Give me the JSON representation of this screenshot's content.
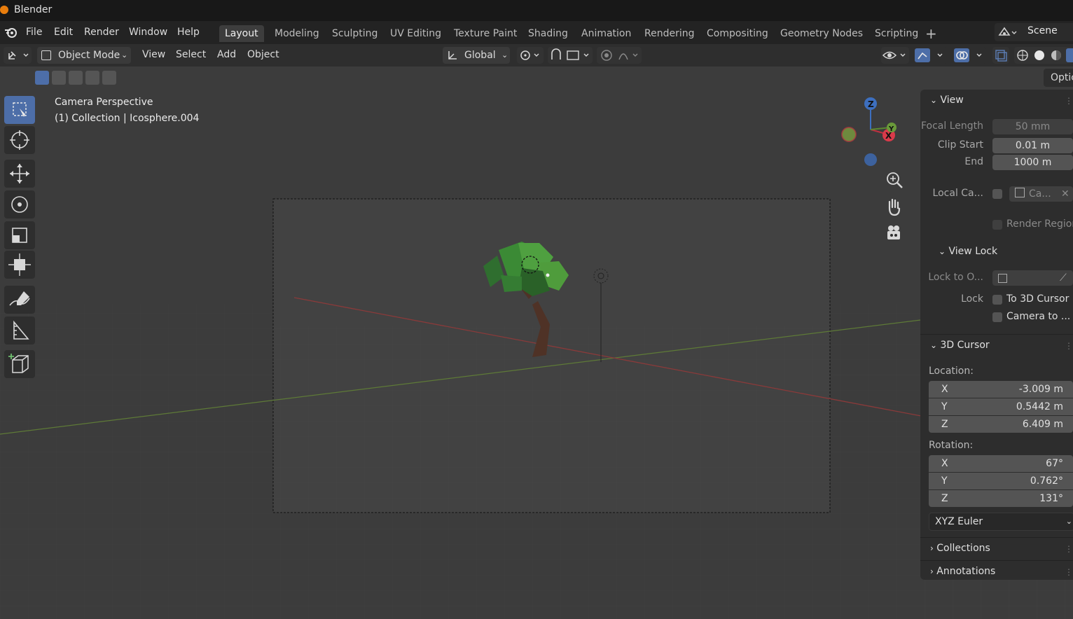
{
  "window": {
    "title": "Blender"
  },
  "menu": [
    "File",
    "Edit",
    "Render",
    "Window",
    "Help"
  ],
  "workspaces": [
    "Layout",
    "Modeling",
    "Sculpting",
    "UV Editing",
    "Texture Paint",
    "Shading",
    "Animation",
    "Rendering",
    "Compositing",
    "Geometry Nodes",
    "Scripting"
  ],
  "active_workspace": "Layout",
  "scene": {
    "name": "Scene"
  },
  "header": {
    "mode": "Object Mode",
    "view": "View",
    "select": "Select",
    "add": "Add",
    "object": "Object",
    "orientation": "Global",
    "options": "Optic"
  },
  "viewport": {
    "title": "Camera Perspective",
    "subtitle": "(1) Collection | Icosphere.004",
    "gizmo": {
      "x": "X",
      "y": "Y",
      "z": "Z"
    }
  },
  "npanel": {
    "view": {
      "title": "View",
      "focal_label": "Focal Length",
      "focal_value": "50 mm",
      "clip_start_label": "Clip Start",
      "clip_start_value": "0.01 m",
      "end_label": "End",
      "end_value": "1000 m",
      "local_camera_label": "Local Ca...",
      "local_camera_value": "Ca...",
      "render_region": "Render Region"
    },
    "view_lock": {
      "title": "View Lock",
      "lock_to_label": "Lock to O...",
      "lock_label": "Lock",
      "to_cursor": "To 3D Cursor",
      "camera_to": "Camera to ..."
    },
    "cursor": {
      "title": "3D Cursor",
      "location_label": "Location:",
      "loc": {
        "x_label": "X",
        "x": "-3.009 m",
        "y_label": "Y",
        "y": "0.5442 m",
        "z_label": "Z",
        "z": "6.409 m"
      },
      "rotation_label": "Rotation:",
      "rot": {
        "x_label": "X",
        "x": "67°",
        "y_label": "Y",
        "y": "0.762°",
        "z_label": "Z",
        "z": "131°"
      },
      "mode": "XYZ Euler"
    },
    "collections": "Collections",
    "annotations": "Annotations"
  }
}
